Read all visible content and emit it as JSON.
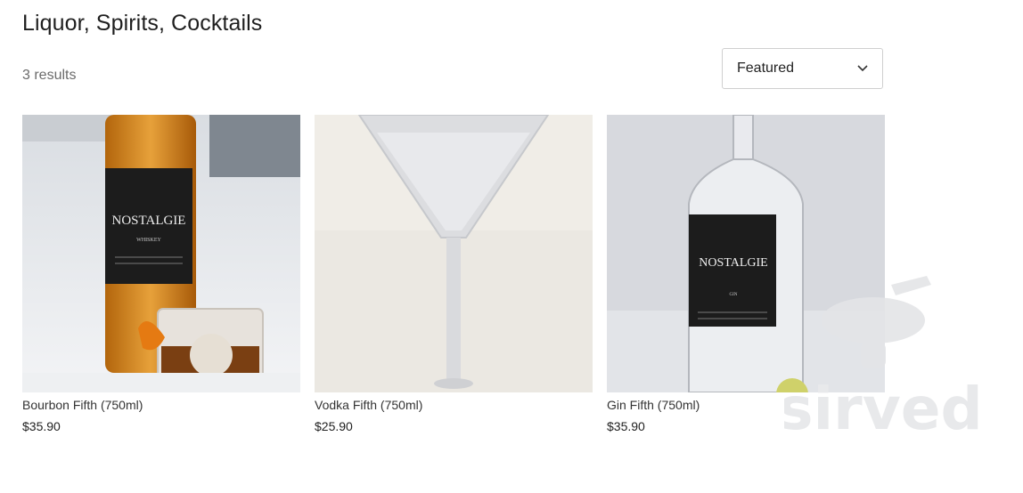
{
  "page": {
    "title": "Liquor, Spirits, Cocktails",
    "results": "3 results"
  },
  "sort": {
    "selected": "Featured"
  },
  "products": [
    {
      "name": "Bourbon Fifth (750ml)",
      "price": "$35.90",
      "image": "bourbon-bottle-image"
    },
    {
      "name": "Vodka Fifth (750ml)",
      "price": "$25.90",
      "image": "martini-glass-image"
    },
    {
      "name": "Gin Fifth (750ml)",
      "price": "$35.90",
      "image": "gin-bottle-image"
    }
  ],
  "image_labels": {
    "bourbon_brand": "NOSTALGIE",
    "bourbon_type": "WHISKEY",
    "gin_brand": "NOSTALGIE",
    "gin_type": "GIN"
  },
  "watermark": {
    "text": "sirved"
  }
}
